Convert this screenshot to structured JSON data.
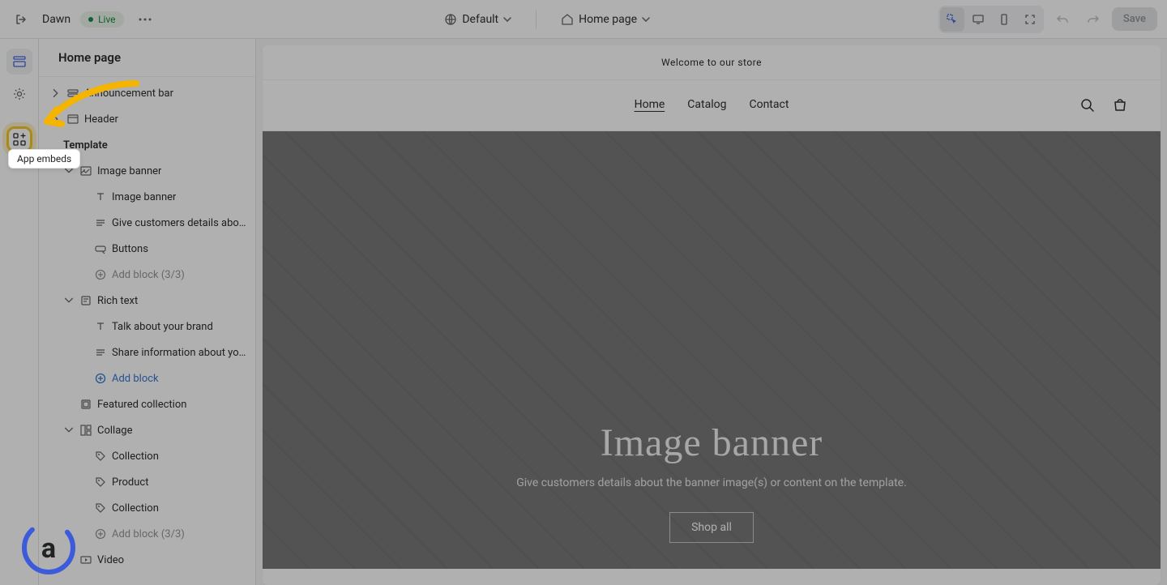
{
  "topbar": {
    "theme_name": "Dawn",
    "live_label": "Live",
    "default_label": "Default",
    "page_label": "Home page",
    "save_label": "Save"
  },
  "rail": {
    "tooltip": "App embeds"
  },
  "sidebar": {
    "title": "Home page",
    "items": [
      {
        "label": "Announcement bar",
        "chev": "right",
        "indent": 0,
        "icon": "section",
        "interactable": true
      },
      {
        "label": "Header",
        "chev": "right",
        "indent": 0,
        "icon": "header",
        "interactable": true
      },
      {
        "label": "Template",
        "chev": "none",
        "indent": 0,
        "header": true,
        "interactable": false
      },
      {
        "label": "Image banner",
        "chev": "down",
        "indent": 1,
        "icon": "image",
        "interactable": true
      },
      {
        "label": "Image banner",
        "chev": "none",
        "indent": 2,
        "icon": "text",
        "interactable": true
      },
      {
        "label": "Give customers details about the...",
        "chev": "none",
        "indent": 2,
        "icon": "desc",
        "interactable": true
      },
      {
        "label": "Buttons",
        "chev": "none",
        "indent": 2,
        "icon": "button",
        "interactable": true
      },
      {
        "label": "Add block (3/3)",
        "chev": "none",
        "indent": 2,
        "icon": "add",
        "muted": true,
        "interactable": false
      },
      {
        "label": "Rich text",
        "chev": "down",
        "indent": 1,
        "icon": "richtext",
        "interactable": true
      },
      {
        "label": "Talk about your brand",
        "chev": "none",
        "indent": 2,
        "icon": "text",
        "interactable": true
      },
      {
        "label": "Share information about your bra...",
        "chev": "none",
        "indent": 2,
        "icon": "desc",
        "interactable": true
      },
      {
        "label": "Add block",
        "chev": "none",
        "indent": 2,
        "icon": "add",
        "link": true,
        "interactable": true
      },
      {
        "label": "Featured collection",
        "chev": "none",
        "indent": 1,
        "icon": "collection",
        "interactable": true
      },
      {
        "label": "Collage",
        "chev": "down",
        "indent": 1,
        "icon": "collage",
        "interactable": true
      },
      {
        "label": "Collection",
        "chev": "none",
        "indent": 2,
        "icon": "tag",
        "interactable": true
      },
      {
        "label": "Product",
        "chev": "none",
        "indent": 2,
        "icon": "tag",
        "interactable": true
      },
      {
        "label": "Collection",
        "chev": "none",
        "indent": 2,
        "icon": "tag",
        "interactable": true
      },
      {
        "label": "Add block (3/3)",
        "chev": "none",
        "indent": 2,
        "icon": "add",
        "muted": true,
        "interactable": false
      },
      {
        "label": "Video",
        "chev": "none",
        "indent": 1,
        "icon": "video",
        "interactable": true
      }
    ]
  },
  "preview": {
    "announcement": "Welcome to our store",
    "nav": {
      "home": "Home",
      "catalog": "Catalog",
      "contact": "Contact"
    },
    "banner": {
      "title": "Image banner",
      "subtitle": "Give customers details about the banner image(s) or content on the template.",
      "button": "Shop all"
    }
  }
}
